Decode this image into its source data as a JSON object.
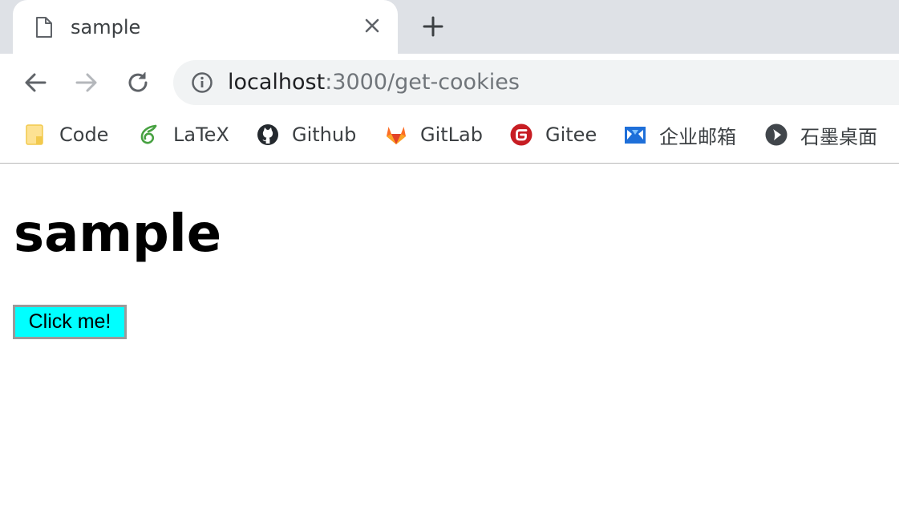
{
  "tab": {
    "title": "sample",
    "close_icon": "close-icon",
    "page_icon": "page-icon"
  },
  "new_tab_icon": "plus-icon",
  "toolbar": {
    "back_icon": "arrow-left-icon",
    "forward_icon": "arrow-right-icon",
    "reload_icon": "reload-icon",
    "address": {
      "host": "localhost",
      "rest": ":3000/get-cookies",
      "info_icon": "info-icon"
    }
  },
  "bookmarks": [
    {
      "label": "Code",
      "icon": "folder-icon"
    },
    {
      "label": "LaTeX",
      "icon": "overleaf-icon"
    },
    {
      "label": "Github",
      "icon": "github-icon"
    },
    {
      "label": "GitLab",
      "icon": "gitlab-icon"
    },
    {
      "label": "Gitee",
      "icon": "gitee-icon"
    },
    {
      "label": "企业邮箱",
      "icon": "mail-icon"
    },
    {
      "label": "石墨桌面",
      "icon": "shimo-icon"
    }
  ],
  "page": {
    "heading": "sample",
    "button_label": "Click me!"
  },
  "colors": {
    "tabstrip": "#dee1e6",
    "omnibox": "#f1f3f4",
    "button_bg": "#00ffff",
    "url_rest": "#70757a"
  }
}
